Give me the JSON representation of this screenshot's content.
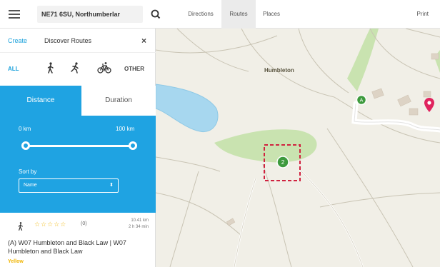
{
  "topbar": {
    "search_value": "NE71 6SU, Northumberlar",
    "tabs": [
      {
        "label": "Directions"
      },
      {
        "label": "Routes",
        "active": true
      },
      {
        "label": "Places"
      }
    ],
    "print": "Print"
  },
  "sidebar": {
    "create": "Create",
    "discover": "Discover Routes",
    "close": "×",
    "activities": {
      "all": "ALL",
      "other": "OTHER",
      "icons": [
        "walk-icon",
        "run-icon",
        "cycle-icon"
      ]
    },
    "segment": {
      "distance": "Distance",
      "duration": "Duration",
      "selected": "distance"
    },
    "range": {
      "min_label": "0 km",
      "max_label": "100 km",
      "min_fraction": 0.0,
      "max_fraction": 1.0
    },
    "sort": {
      "label": "Sort by",
      "value": "Name"
    },
    "result": {
      "stars": "☆☆☆☆☆",
      "count": "(0)",
      "distance": "10.41 km",
      "duration": "2 h 34 min",
      "title": "(A) W07 Humbleton and Black Law | W07 Humbleton and Black Law",
      "grade": "Yellow"
    }
  },
  "map": {
    "place_name": "Humbleton",
    "marker_a": "A",
    "marker_2": "2",
    "colors": {
      "accent": "#1fa3e2",
      "star": "#f0b400",
      "pin": "#e0245e",
      "poi": "#3d9a3d",
      "land": "#f1efe7",
      "green": "#c9e3b0",
      "water": "#a7d7ef"
    }
  }
}
